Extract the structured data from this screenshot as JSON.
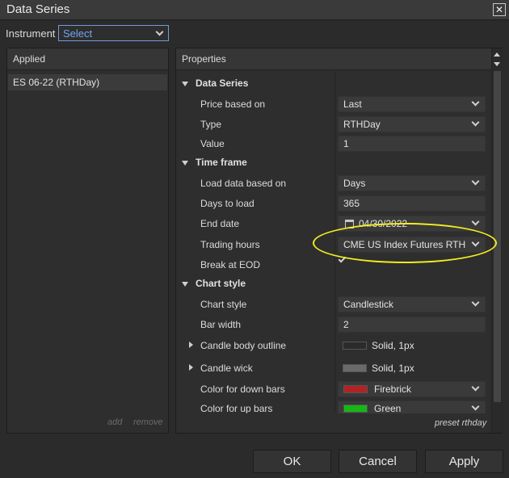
{
  "window": {
    "title": "Data Series"
  },
  "instrument": {
    "label": "Instrument",
    "value": "Select"
  },
  "applied": {
    "header": "Applied",
    "items": [
      "ES 06-22 (RTHDay)"
    ],
    "add_label": "add",
    "remove_label": "remove"
  },
  "properties": {
    "header": "Properties",
    "preset_label": "preset rthday",
    "data_series": {
      "label": "Data Series",
      "price_based_on": {
        "label": "Price based on",
        "value": "Last"
      },
      "type": {
        "label": "Type",
        "value": "RTHDay"
      },
      "value": {
        "label": "Value",
        "value": "1"
      }
    },
    "time_frame": {
      "label": "Time frame",
      "load_data_based_on": {
        "label": "Load data based on",
        "value": "Days"
      },
      "days_to_load": {
        "label": "Days to load",
        "value": "365"
      },
      "end_date": {
        "label": "End date",
        "value": "04/30/2022"
      },
      "trading_hours": {
        "label": "Trading hours",
        "value": "CME US Index Futures RTH"
      },
      "break_at_eod": {
        "label": "Break at EOD",
        "checked": true
      }
    },
    "chart_style": {
      "label": "Chart style",
      "chart_style": {
        "label": "Chart style",
        "value": "Candlestick"
      },
      "bar_width": {
        "label": "Bar width",
        "value": "2"
      },
      "candle_body_outline": {
        "label": "Candle body outline",
        "value": "Solid, 1px",
        "color": "#2b2b2b"
      },
      "candle_wick": {
        "label": "Candle wick",
        "value": "Solid, 1px",
        "color": "#6a6a6a"
      },
      "color_for_down_bars": {
        "label": "Color for down bars",
        "value": "Firebrick",
        "color": "#b22222"
      },
      "color_for_up_bars": {
        "label": "Color for up bars",
        "value": "Green",
        "color": "#15b815"
      }
    }
  },
  "buttons": {
    "ok": "OK",
    "cancel": "Cancel",
    "apply": "Apply"
  },
  "colors": {
    "highlight_ellipse": "#f2ec1f",
    "instrument_text": "#6fa7ee"
  }
}
